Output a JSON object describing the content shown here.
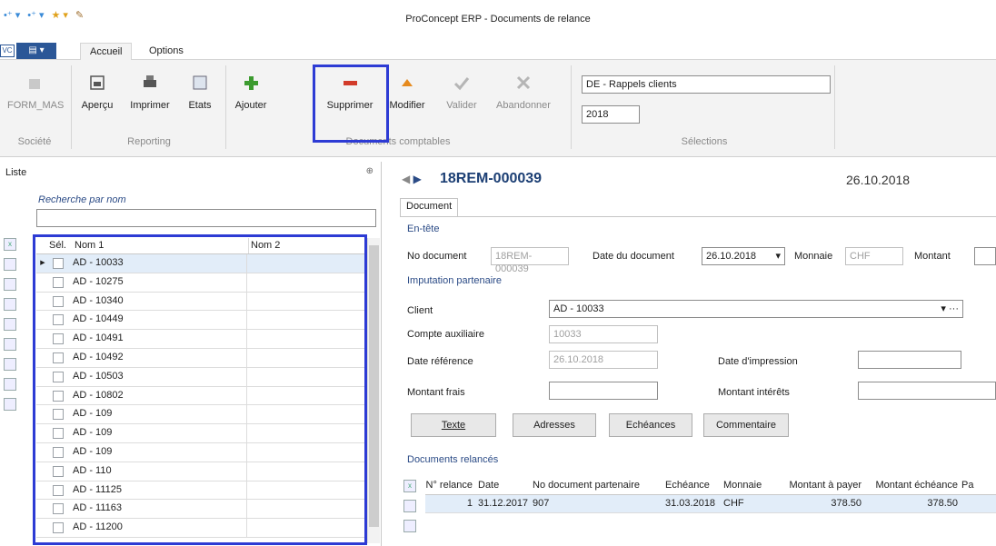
{
  "window": {
    "title": "ProConcept ERP - Documents de relance"
  },
  "tabs": [
    {
      "label": "Accueil",
      "active": true
    },
    {
      "label": "Options",
      "active": false
    }
  ],
  "app_button": "",
  "vc_label": "VC",
  "ribbon": {
    "societe": {
      "form_mas": "FORM_MAS",
      "group": "Société"
    },
    "reporting": {
      "apercu": "Aperçu",
      "imprimer": "Imprimer",
      "etats": "Etats",
      "group": "Reporting"
    },
    "documents": {
      "ajouter": "Ajouter",
      "supprimer": "Supprimer",
      "modifier": "Modifier",
      "valider": "Valider",
      "abandonner": "Abandonner",
      "group": "Documents comptables"
    },
    "selections": {
      "select1": "DE - Rappels clients",
      "select2": "2018",
      "group": "Sélections"
    }
  },
  "left_panel": {
    "title": "Liste",
    "search_label": "Recherche par nom",
    "search_value": "",
    "columns": {
      "sel": "Sél.",
      "nom1": "Nom 1",
      "nom2": "Nom 2"
    },
    "rows": [
      {
        "nom1": "AD - 10033",
        "nom2": "",
        "active": true
      },
      {
        "nom1": "AD - 10275",
        "nom2": ""
      },
      {
        "nom1": "AD - 10340",
        "nom2": ""
      },
      {
        "nom1": "AD - 10449",
        "nom2": ""
      },
      {
        "nom1": "AD - 10491",
        "nom2": ""
      },
      {
        "nom1": "AD - 10492",
        "nom2": ""
      },
      {
        "nom1": "AD - 10503",
        "nom2": ""
      },
      {
        "nom1": "AD - 10802",
        "nom2": ""
      },
      {
        "nom1": "AD - 109",
        "nom2": ""
      },
      {
        "nom1": "AD - 109",
        "nom2": ""
      },
      {
        "nom1": "AD - 109",
        "nom2": ""
      },
      {
        "nom1": "AD - 110",
        "nom2": ""
      },
      {
        "nom1": "AD - 11125",
        "nom2": ""
      },
      {
        "nom1": "AD - 11163",
        "nom2": ""
      },
      {
        "nom1": "AD - 11200",
        "nom2": ""
      }
    ]
  },
  "detail": {
    "doc_number": "18REM-000039",
    "doc_date": "26.10.2018",
    "tab": "Document",
    "section_header": "En-tête",
    "no_document_label": "No document",
    "no_document_value": "18REM-000039",
    "date_document_label": "Date du document",
    "date_document_value": "26.10.2018",
    "monnaie_label": "Monnaie",
    "monnaie_value": "CHF",
    "montant_label": "Montant",
    "section_imputation": "Imputation partenaire",
    "client_label": "Client",
    "client_value": "AD - 10033",
    "compte_label": "Compte auxiliaire",
    "compte_value": "10033",
    "date_ref_label": "Date référence",
    "date_ref_value": "26.10.2018",
    "date_impression_label": "Date d'impression",
    "montant_frais_label": "Montant frais",
    "montant_interets_label": "Montant intérêts",
    "buttons": {
      "texte": "Texte",
      "adresses": "Adresses",
      "echeances": "Echéances",
      "commentaire": "Commentaire"
    },
    "section_docs": "Documents relancés",
    "docs_columns": [
      "N° relance",
      "Date",
      "No document partenaire",
      "Echéance",
      "Monnaie",
      "Montant à payer",
      "Montant échéance",
      "Pa"
    ],
    "docs_rows": [
      {
        "relance": "1",
        "date": "31.12.2017",
        "no_doc": "907",
        "echeance": "31.03.2018",
        "monnaie": "CHF",
        "montant_payer": "378.50",
        "montant_echeance": "378.50"
      }
    ]
  }
}
